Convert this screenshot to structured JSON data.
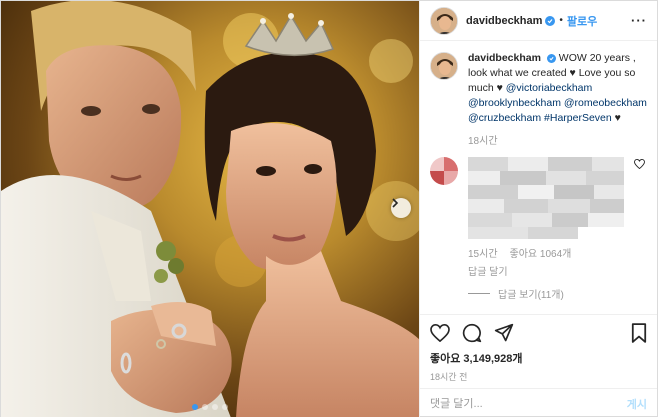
{
  "header": {
    "username": "davidbeckham",
    "separator": "•",
    "follow_label": "팔로우",
    "more_label": "···"
  },
  "caption": {
    "username": "davidbeckham",
    "text_intro": "WOW 20 years , look what we created ♥ Love you so much ♥",
    "mentions": [
      "@victoriabeckham",
      "@brooklynbeckham",
      "@romeobeckham",
      "@cruzbeckham"
    ],
    "hashtag": "#HarperSeven",
    "end_heart": "♥",
    "time": "18시간"
  },
  "comment": {
    "time": "15시간",
    "likes": "좋아요 1064개",
    "reply_label": "답글 달기",
    "view_replies_label": "답글 보기(11개)"
  },
  "actions": {
    "likes_text": "좋아요 3,149,928개",
    "date_text": "18시간 전"
  },
  "add_comment": {
    "placeholder": "댓글 달기...",
    "post_label": "게시"
  },
  "carousel": {
    "slide_count": 4,
    "active_index": 0
  },
  "colors": {
    "accent": "#3897f0",
    "text": "#262626",
    "muted": "#999999",
    "border": "#efefef"
  }
}
